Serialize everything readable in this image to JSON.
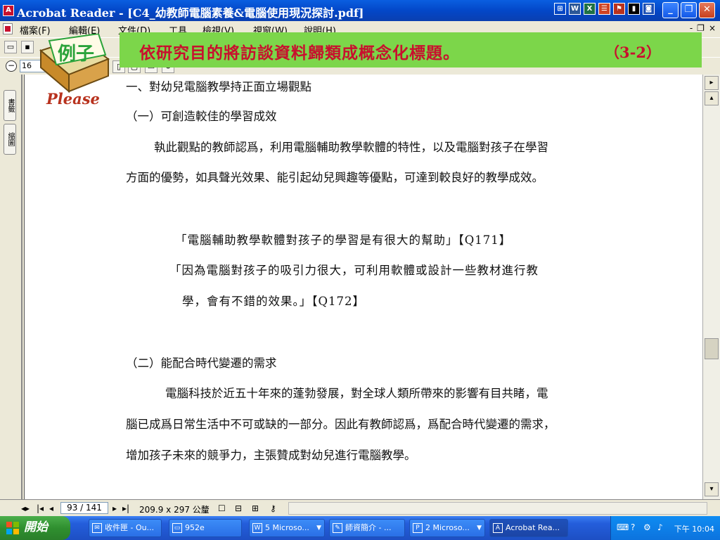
{
  "window": {
    "title": "Acrobat Reader - [C4_幼教師電腦素養&電腦使用現況探討.pdf]",
    "tray_icons": [
      "⊞",
      "W",
      "X",
      "☰",
      "⚑",
      "▮",
      "◙"
    ],
    "minimize": "_",
    "restore": "❐",
    "close": "✕"
  },
  "menu": {
    "items": [
      "檔案(F)",
      "編輯(E)",
      "文件(D)",
      "工具",
      "檢視(V)",
      "視窗(W)",
      "說明(H)"
    ],
    "mdi_min": "-",
    "mdi_restore": "❐",
    "mdi_close": "×"
  },
  "toolbar": {
    "zoom": "16"
  },
  "side_tabs": [
    "書籤",
    "縮圖"
  ],
  "overlay": {
    "badge": "例子",
    "please": "Please",
    "banner": "依研究目的將訪談資料歸類成概念化標題。",
    "banner_count": "（3-2）"
  },
  "document": {
    "heading1": "一、對幼兒電腦教學持正面立場觀點",
    "sub1": "（一）可創造較佳的學習成效",
    "para1_line1": "執此觀點的教師認爲，利用電腦輔助教學軟體的特性，以及電腦對孩子在學習",
    "para1_line2": "方面的優勢，如具聲光效果、能引起幼兒興趣等優點，可達到較良好的教學成效。",
    "quote1": "「電腦輔助教學軟體對孩子的學習是有很大的幫助」【Q171】",
    "quote2_line1": "「因為電腦對孩子的吸引力很大，可利用軟體或設計一些教材進行教",
    "quote2_line2": "學，會有不錯的效果。」【Q172】",
    "sub2": "（二）能配合時代變遷的需求",
    "para2_line1": "電腦科技於近五十年來的蓬勃發展，對全球人類所帶來的影響有目共睹，電",
    "para2_line2": "腦已成爲日常生活中不可或缺的一部分。因此有教師認爲，爲配合時代變遷的需求，",
    "para2_line3": "增加孩子未來的競爭力，主張贊成對幼兒進行電腦教學。"
  },
  "status": {
    "page": "93 / 141",
    "page_size": "209.9 x 297 公釐"
  },
  "taskbar": {
    "start": "開始",
    "tasks": [
      {
        "label": "收件匣 - Ou...",
        "icon": "✉"
      },
      {
        "label": "952e",
        "icon": "▭"
      },
      {
        "label": "5 Microso...",
        "icon": "W"
      },
      {
        "label": "師資簡介 - ...",
        "icon": "✎"
      },
      {
        "label": "2 Microso...",
        "icon": "P"
      },
      {
        "label": "Acrobat Rea...",
        "icon": "A"
      }
    ],
    "clock": "下午 10:04"
  },
  "colors": {
    "banner_bg": "#7cd64a",
    "banner_text": "#c8102e",
    "badge_text": "#2aa33a",
    "please_text": "#b8321e"
  }
}
